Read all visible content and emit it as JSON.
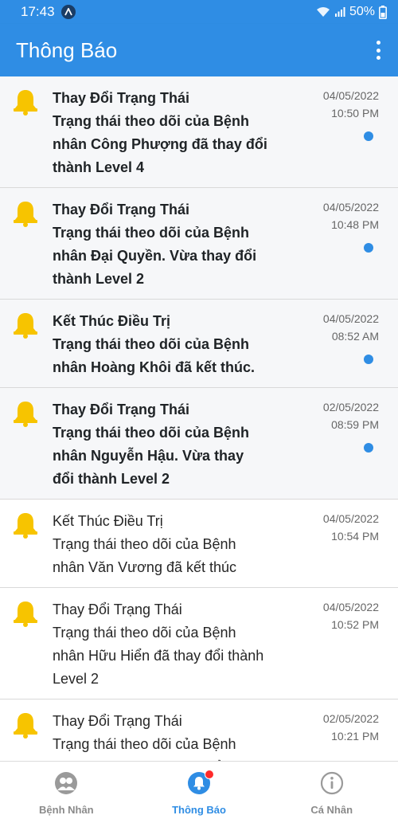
{
  "status_bar": {
    "time": "17:43",
    "battery": "50%"
  },
  "header": {
    "title": "Thông Báo"
  },
  "notifications": [
    {
      "title": "Thay Đổi Trạng Thái",
      "message": "Trạng thái theo dõi của Bệnh nhân Công Phượng đã thay đổi thành Level 4",
      "date": "04/05/2022",
      "time": "10:50 PM",
      "unread": true
    },
    {
      "title": "Thay Đổi Trạng Thái",
      "message": "Trạng thái theo dõi của Bệnh nhân Đại Quyền. Vừa thay đổi thành Level 2",
      "date": "04/05/2022",
      "time": "10:48 PM",
      "unread": true
    },
    {
      "title": "Kết Thúc Điều Trị",
      "message": "Trạng thái theo dõi của Bệnh nhân Hoàng Khôi đã kết thúc.",
      "date": "04/05/2022",
      "time": "08:52 AM",
      "unread": true
    },
    {
      "title": "Thay Đổi Trạng Thái",
      "message": "Trạng thái theo dõi của Bệnh nhân Nguyễn Hậu. Vừa thay đổi thành Level 2",
      "date": "02/05/2022",
      "time": "08:59 PM",
      "unread": true
    },
    {
      "title": "Kết Thúc Điều Trị",
      "message": "Trạng thái theo dõi của Bệnh nhân Văn Vương đã kết thúc",
      "date": "04/05/2022",
      "time": "10:54 PM",
      "unread": false
    },
    {
      "title": "Thay Đổi Trạng Thái",
      "message": "Trạng thái theo dõi của Bệnh nhân Hữu Hiển đã thay đổi thành Level 2",
      "date": "04/05/2022",
      "time": "10:52 PM",
      "unread": false
    },
    {
      "title": "Thay Đổi Trạng Thái",
      "message": "Trạng thái theo dõi của Bệnh nhân Văn Tùng đã thay đổi thành",
      "date": "02/05/2022",
      "time": "10:21 PM",
      "unread": false
    }
  ],
  "bottom_nav": {
    "items": [
      {
        "label": "Bệnh Nhân",
        "icon": "patients-icon",
        "active": false
      },
      {
        "label": "Thông Báo",
        "icon": "bell-icon",
        "active": true
      },
      {
        "label": "Cá Nhân",
        "icon": "info-icon",
        "active": false
      }
    ]
  },
  "colors": {
    "primary": "#2f8de4",
    "bell": "#f7c400",
    "badge": "#ff2a2a"
  }
}
